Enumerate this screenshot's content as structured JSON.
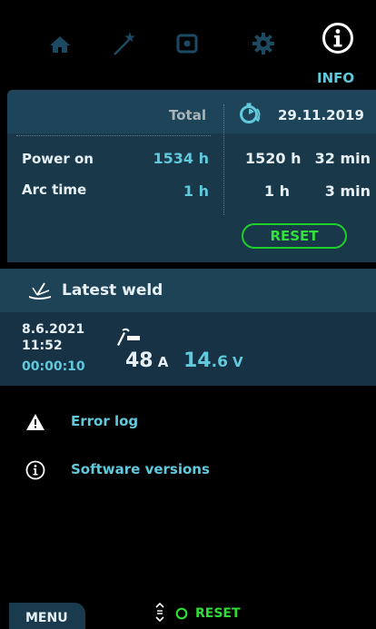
{
  "nav": {
    "items": [
      {
        "icon": "home-icon"
      },
      {
        "icon": "magic-wand-icon"
      },
      {
        "icon": "record-icon"
      },
      {
        "icon": "gear-icon"
      },
      {
        "icon": "info-icon",
        "label": "INFO",
        "active": true
      }
    ]
  },
  "stats": {
    "total_label": "Total",
    "date": "29.11.2019",
    "power_on_label": "Power on",
    "power_on_total": "1534 h",
    "power_on_since_h": "1520 h",
    "power_on_since_min": "32 min",
    "arc_time_label": "Arc time",
    "arc_time_total": "1 h",
    "arc_time_since_h": "1 h",
    "arc_time_since_min": "3 min",
    "reset_label": "RESET"
  },
  "latest_weld": {
    "title": "Latest weld",
    "date": "8.6.2021",
    "time": "11:52",
    "duration": "00:00:10",
    "current_value": "48",
    "current_unit": "A",
    "voltage_int": "14",
    "voltage_dec": ".6",
    "voltage_unit": "V"
  },
  "list": {
    "error_log": "Error log",
    "software_versions": "Software versions"
  },
  "footer": {
    "menu_label": "MENU",
    "reset_label": "RESET"
  },
  "colors": {
    "accent_cyan": "#62c8dc",
    "reset_green": "#1fcf2a",
    "panel": "#19394a"
  }
}
